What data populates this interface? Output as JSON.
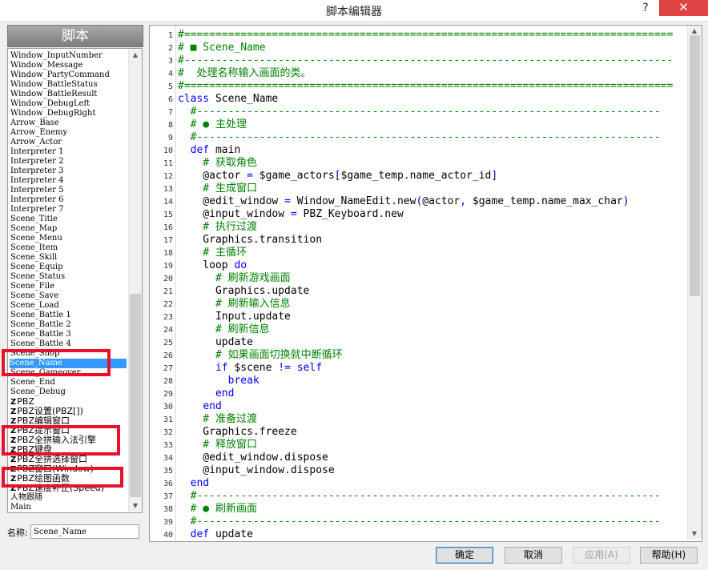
{
  "window": {
    "title": "脚本编辑器",
    "help_glyph": "?",
    "close_glyph": "✕"
  },
  "script_panel": {
    "header": "脚本",
    "items": [
      {
        "label": "Window_InputNumber"
      },
      {
        "label": "Window_Message"
      },
      {
        "label": "Window_PartyCommand"
      },
      {
        "label": "Window_BattleStatus"
      },
      {
        "label": "Window_BattleResult"
      },
      {
        "label": "Window_DebugLeft"
      },
      {
        "label": "Window_DebugRight"
      },
      {
        "label": "Arrow_Base"
      },
      {
        "label": "Arrow_Enemy"
      },
      {
        "label": "Arrow_Actor"
      },
      {
        "label": "Interpreter 1"
      },
      {
        "label": "Interpreter 2"
      },
      {
        "label": "Interpreter 3"
      },
      {
        "label": "Interpreter 4"
      },
      {
        "label": "Interpreter 5"
      },
      {
        "label": "Interpreter 6"
      },
      {
        "label": "Interpreter 7"
      },
      {
        "label": "Scene_Title"
      },
      {
        "label": "Scene_Map"
      },
      {
        "label": "Scene_Menu"
      },
      {
        "label": "Scene_Item"
      },
      {
        "label": "Scene_Skill"
      },
      {
        "label": "Scene_Equip"
      },
      {
        "label": "Scene_Status"
      },
      {
        "label": "Scene_File"
      },
      {
        "label": "Scene_Save"
      },
      {
        "label": "Scene_Load"
      },
      {
        "label": "Scene_Battle 1"
      },
      {
        "label": "Scene_Battle 2"
      },
      {
        "label": "Scene_Battle 3"
      },
      {
        "label": "Scene_Battle 4"
      },
      {
        "label": "Scene_Shop"
      },
      {
        "label": "Scene_Name"
      },
      {
        "label": "Scene_Gameover"
      },
      {
        "label": "Scene_End"
      },
      {
        "label": "Scene_Debug"
      },
      {
        "label": "PBZ",
        "z": "Z"
      },
      {
        "label": "PBZ设置(PBZ[])",
        "z": "Z"
      },
      {
        "label": "PBZ编辑窗口",
        "z": "Z"
      },
      {
        "label": "PBZ提示窗口",
        "z": "Z"
      },
      {
        "label": "PBZ全拼输入法引擎",
        "z": "Z"
      },
      {
        "label": "PBZ键盘",
        "z": "Z"
      },
      {
        "label": "PBZ全拼选择窗口",
        "z": "Z"
      },
      {
        "label": "PBZ窗口(Window)",
        "z": "Z"
      },
      {
        "label": "PBZ绘图函数",
        "z": "Z"
      },
      {
        "label": "PBZ速度补正(Speed)",
        "z": "Z"
      },
      {
        "label": "人物跟随"
      },
      {
        "label": "Main"
      }
    ],
    "selected": "Scene_Name"
  },
  "name_field": {
    "label": "名称:",
    "value": "Scene_Name"
  },
  "editor": {
    "line_numbers": [
      "1",
      "2",
      "3",
      "4",
      "5",
      "6",
      "7",
      "8",
      "9",
      "10",
      "11",
      "12",
      "13",
      "14",
      "15",
      "16",
      "17",
      "18",
      "19",
      "20",
      "21",
      "22",
      "23",
      "24",
      "25",
      "26",
      "27",
      "28",
      "29",
      "30",
      "31",
      "32",
      "33",
      "34",
      "35",
      "36",
      "37",
      "38",
      "39",
      "40"
    ],
    "lines": [
      [
        {
          "t": "#==============================================================================",
          "c": "c"
        }
      ],
      [
        {
          "t": "# ■ Scene_Name",
          "c": "c"
        }
      ],
      [
        {
          "t": "#------------------------------------------------------------------------------",
          "c": "c"
        }
      ],
      [
        {
          "t": "#  处理名称输入画面的类。",
          "c": "c"
        }
      ],
      [
        {
          "t": "#==============================================================================",
          "c": "c"
        }
      ],
      [
        {
          "t": "class",
          "c": "k"
        },
        {
          "t": " Scene_Name",
          "c": ""
        }
      ],
      [
        {
          "t": "  #--------------------------------------------------------------------------",
          "c": "c"
        }
      ],
      [
        {
          "t": "  # ● 主处理",
          "c": "c"
        }
      ],
      [
        {
          "t": "  #--------------------------------------------------------------------------",
          "c": "c"
        }
      ],
      [
        {
          "t": "  ",
          "c": ""
        },
        {
          "t": "def",
          "c": "k"
        },
        {
          "t": " main",
          "c": ""
        }
      ],
      [
        {
          "t": "    # 获取角色",
          "c": "c"
        }
      ],
      [
        {
          "t": "    @actor ",
          "c": ""
        },
        {
          "t": "=",
          "c": "k"
        },
        {
          "t": " $game_actors",
          "c": ""
        },
        {
          "t": "[",
          "c": "br"
        },
        {
          "t": "$game_temp",
          "c": ""
        },
        {
          "t": ".",
          "c": "k"
        },
        {
          "t": "name_actor_id",
          "c": ""
        },
        {
          "t": "]",
          "c": "br"
        }
      ],
      [
        {
          "t": "    # 生成窗口",
          "c": "c"
        }
      ],
      [
        {
          "t": "    @edit_window ",
          "c": ""
        },
        {
          "t": "=",
          "c": "k"
        },
        {
          "t": " Window_NameEdit",
          "c": ""
        },
        {
          "t": ".",
          "c": "k"
        },
        {
          "t": "new",
          "c": ""
        },
        {
          "t": "(",
          "c": "br"
        },
        {
          "t": "@actor",
          "c": ""
        },
        {
          "t": ",",
          "c": "k"
        },
        {
          "t": " $game_temp",
          "c": ""
        },
        {
          "t": ".",
          "c": "k"
        },
        {
          "t": "name_max_char",
          "c": ""
        },
        {
          "t": ")",
          "c": "br"
        }
      ],
      [
        {
          "t": "    @input_window ",
          "c": ""
        },
        {
          "t": "=",
          "c": "k"
        },
        {
          "t": " PBZ_Keyboard",
          "c": ""
        },
        {
          "t": ".",
          "c": "k"
        },
        {
          "t": "new",
          "c": ""
        }
      ],
      [
        {
          "t": "    # 执行过渡",
          "c": "c"
        }
      ],
      [
        {
          "t": "    Graphics",
          "c": ""
        },
        {
          "t": ".",
          "c": "k"
        },
        {
          "t": "transition",
          "c": ""
        }
      ],
      [
        {
          "t": "    # 主循环",
          "c": "c"
        }
      ],
      [
        {
          "t": "    loop ",
          "c": ""
        },
        {
          "t": "do",
          "c": "k"
        }
      ],
      [
        {
          "t": "      # 刷新游戏画面",
          "c": "c"
        }
      ],
      [
        {
          "t": "      Graphics",
          "c": ""
        },
        {
          "t": ".",
          "c": "k"
        },
        {
          "t": "update",
          "c": ""
        }
      ],
      [
        {
          "t": "      # 刷新输入信息",
          "c": "c"
        }
      ],
      [
        {
          "t": "      Input",
          "c": ""
        },
        {
          "t": ".",
          "c": "k"
        },
        {
          "t": "update",
          "c": ""
        }
      ],
      [
        {
          "t": "      # 刷新信息",
          "c": "c"
        }
      ],
      [
        {
          "t": "      update",
          "c": ""
        }
      ],
      [
        {
          "t": "      # 如果画面切换就中断循环",
          "c": "c"
        }
      ],
      [
        {
          "t": "      ",
          "c": ""
        },
        {
          "t": "if",
          "c": "k"
        },
        {
          "t": " $scene ",
          "c": ""
        },
        {
          "t": "!=",
          "c": "k"
        },
        {
          "t": " ",
          "c": ""
        },
        {
          "t": "self",
          "c": "k"
        }
      ],
      [
        {
          "t": "        ",
          "c": ""
        },
        {
          "t": "break",
          "c": "k"
        }
      ],
      [
        {
          "t": "      ",
          "c": ""
        },
        {
          "t": "end",
          "c": "k"
        }
      ],
      [
        {
          "t": "    ",
          "c": ""
        },
        {
          "t": "end",
          "c": "k"
        }
      ],
      [
        {
          "t": "    # 准备过渡",
          "c": "c"
        }
      ],
      [
        {
          "t": "    Graphics",
          "c": ""
        },
        {
          "t": ".",
          "c": "k"
        },
        {
          "t": "freeze",
          "c": ""
        }
      ],
      [
        {
          "t": "    # 释放窗口",
          "c": "c"
        }
      ],
      [
        {
          "t": "    @edit_window",
          "c": ""
        },
        {
          "t": ".",
          "c": "k"
        },
        {
          "t": "dispose",
          "c": ""
        }
      ],
      [
        {
          "t": "    @input_window",
          "c": ""
        },
        {
          "t": ".",
          "c": "k"
        },
        {
          "t": "dispose",
          "c": ""
        }
      ],
      [
        {
          "t": "  ",
          "c": ""
        },
        {
          "t": "end",
          "c": "k"
        }
      ],
      [
        {
          "t": "  #--------------------------------------------------------------------------",
          "c": "c"
        }
      ],
      [
        {
          "t": "  # ● 刷新画面",
          "c": "c"
        }
      ],
      [
        {
          "t": "  #--------------------------------------------------------------------------",
          "c": "c"
        }
      ],
      [
        {
          "t": "  ",
          "c": ""
        },
        {
          "t": "def",
          "c": "k"
        },
        {
          "t": " update",
          "c": ""
        }
      ]
    ]
  },
  "buttons": {
    "ok": "确定",
    "cancel": "取消",
    "apply": "应用(A)",
    "help": "帮助(H)"
  },
  "colors": {
    "comment": "#008000",
    "keyword": "#0000ff",
    "selection": "#3399ff",
    "highlight_box": "#e8102a",
    "close": "#e04343"
  }
}
